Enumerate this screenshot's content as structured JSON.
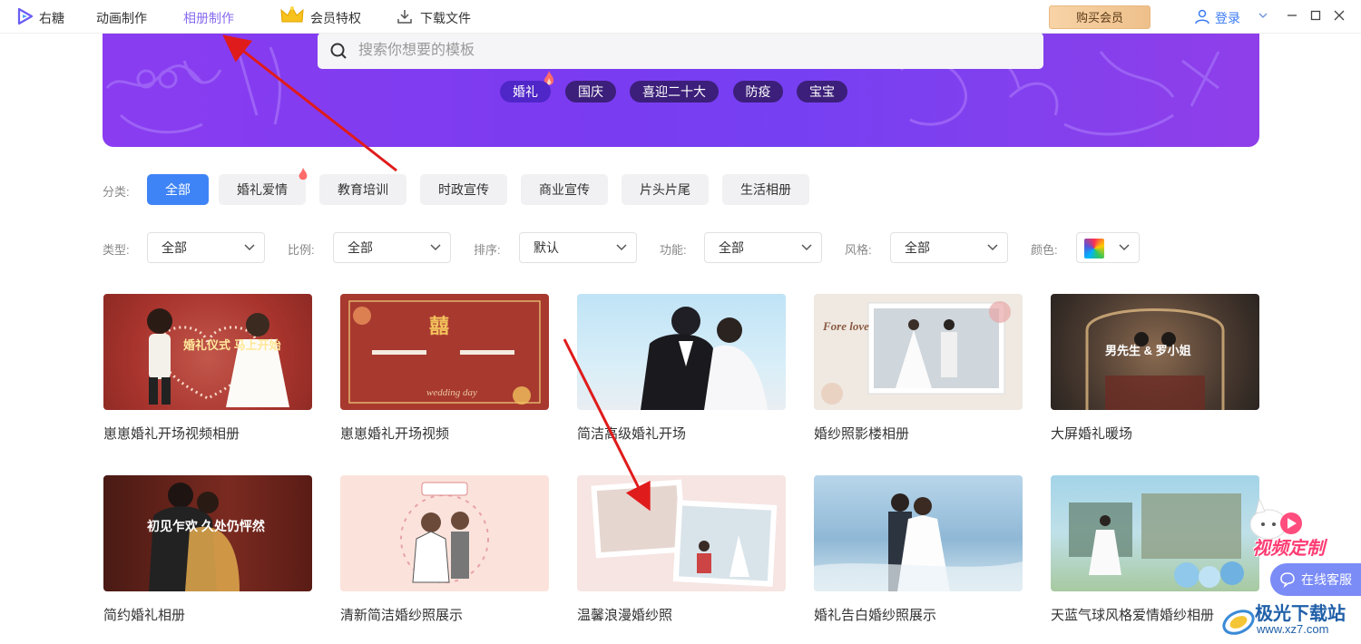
{
  "app": {
    "name": "右糖"
  },
  "nav": {
    "items": [
      "动画制作",
      "相册制作"
    ],
    "vip_label": "会员特权",
    "download_label": "下载文件",
    "buy_label": "购买会员",
    "login_label": "登录"
  },
  "search": {
    "placeholder": "搜索你想要的模板",
    "value": ""
  },
  "hot_tags": [
    "婚礼",
    "国庆",
    "喜迎二十大",
    "防疫",
    "宝宝"
  ],
  "filters": {
    "category_label": "分类:",
    "categories": [
      "全部",
      "婚礼爱情",
      "教育培训",
      "时政宣传",
      "商业宣传",
      "片头片尾",
      "生活相册"
    ],
    "type_label": "类型:",
    "type_value": "全部",
    "ratio_label": "比例:",
    "ratio_value": "全部",
    "sort_label": "排序:",
    "sort_value": "默认",
    "function_label": "功能:",
    "function_value": "全部",
    "style_label": "风格:",
    "style_value": "全部",
    "color_label": "颜色:"
  },
  "cards": [
    {
      "title": "崽崽婚礼开场视频相册",
      "overlay": "婚礼仪式 马上开始"
    },
    {
      "title": "崽崽婚礼开场视频",
      "overlay": "囍"
    },
    {
      "title": "简洁高级婚礼开场"
    },
    {
      "title": "婚纱照影楼相册",
      "overlay": "Fore love"
    },
    {
      "title": "大屏婚礼暖场",
      "overlay": "男先生 & 罗小姐"
    },
    {
      "title": "简约婚礼相册",
      "overlay": "初见乍欢 久处仍怦然"
    },
    {
      "title": "清新简洁婚纱照展示"
    },
    {
      "title": "温馨浪漫婚纱照"
    },
    {
      "title": "婚礼告白婚纱照展示"
    },
    {
      "title": "天蓝气球风格爱情婚纱相册"
    }
  ],
  "float_widget": {
    "label": "视频定制"
  },
  "service": {
    "label": "在线客服"
  },
  "watermark": {
    "title": "极光下载站",
    "url": "www.xz7.com"
  },
  "colors": {
    "accent": "#3f84f6",
    "nav_active": "#8a6cf0",
    "banner": "#7b3bf0"
  }
}
